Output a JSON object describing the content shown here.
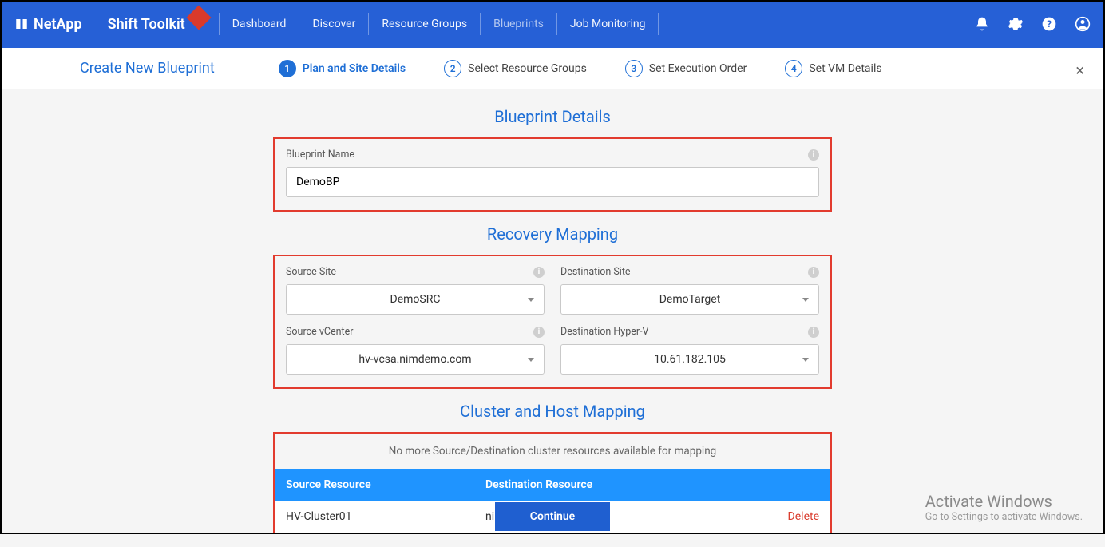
{
  "brand": "NetApp",
  "app_title": "Shift Toolkit",
  "nav": {
    "dashboard": "Dashboard",
    "discover": "Discover",
    "resource_groups": "Resource Groups",
    "blueprints": "Blueprints",
    "job_monitoring": "Job Monitoring"
  },
  "subheader": {
    "title": "Create New Blueprint",
    "steps": {
      "s1": "Plan and Site Details",
      "s2": "Select Resource Groups",
      "s3": "Set Execution Order",
      "s4": "Set VM Details"
    }
  },
  "sections": {
    "blueprint_details_title": "Blueprint Details",
    "recovery_mapping_title": "Recovery Mapping",
    "cluster_host_title": "Cluster and Host Mapping"
  },
  "bp": {
    "name_label": "Blueprint Name",
    "name_value": "DemoBP"
  },
  "mapping": {
    "source_site_label": "Source Site",
    "source_site_value": "DemoSRC",
    "dest_site_label": "Destination Site",
    "dest_site_value": "DemoTarget",
    "source_vcenter_label": "Source vCenter",
    "source_vcenter_value": "hv-vcsa.nimdemo.com",
    "dest_hv_label": "Destination Hyper-V",
    "dest_hv_value": "10.61.182.105"
  },
  "cluster": {
    "no_more": "No more Source/Destination cluster resources available for mapping",
    "header_source": "Source Resource",
    "header_dest": "Destination Resource",
    "row_source": "HV-Cluster01",
    "row_dest": "nimHVHost01",
    "delete": "Delete"
  },
  "continue_label": "Continue",
  "watermark": {
    "line1": "Activate Windows",
    "line2": "Go to Settings to activate Windows."
  },
  "step_numbers": {
    "n1": "1",
    "n2": "2",
    "n3": "3",
    "n4": "4"
  }
}
